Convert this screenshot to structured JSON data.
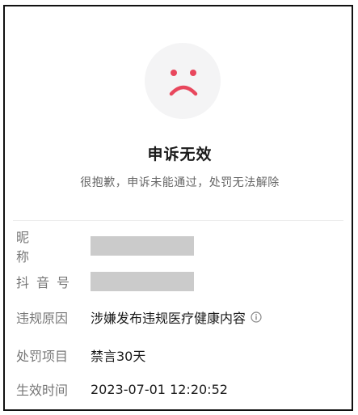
{
  "result": {
    "title": "申诉无效",
    "subtitle": "很抱歉，申诉未能通过，处罚无法解除",
    "status_icon": "sad-face-icon",
    "accent_color": "#e8475d"
  },
  "details": {
    "nickname_label": "昵 称",
    "douyin_id_label": "抖音号",
    "violation_reason_label": "违规原因",
    "violation_reason_value": "涉嫌发布违规医疗健康内容",
    "penalty_label": "处罚项目",
    "penalty_value": "禁言30天",
    "effective_time_label": "生效时间",
    "effective_time_value": "2023-07-01 12:20:52",
    "info_icon": "info-circle-icon"
  }
}
